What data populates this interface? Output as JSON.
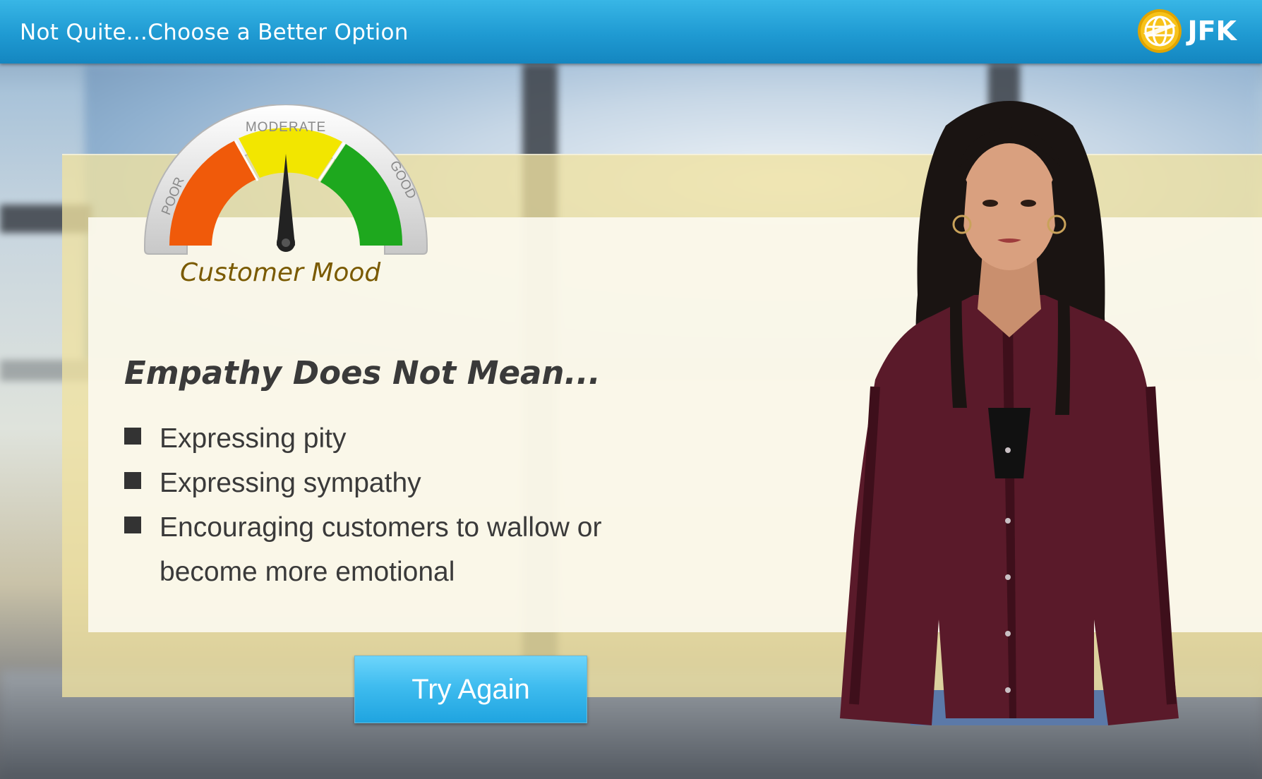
{
  "header": {
    "title": "Not Quite...Choose a Better Option",
    "logo_text": "JFK"
  },
  "gauge": {
    "labels": {
      "poor": "POOR",
      "moderate": "MODERATE",
      "good": "GOOD"
    },
    "caption": "Customer Mood",
    "level": "moderate",
    "colors": {
      "poor": "#f05a0a",
      "moderate": "#f2e600",
      "good": "#1ea81e"
    }
  },
  "content": {
    "heading": "Empathy Does Not Mean...",
    "bullets": [
      "Expressing pity",
      "Expressing sympathy",
      "Encouraging customers to wallow or become more emotional"
    ]
  },
  "actions": {
    "try_again_label": "Try Again"
  },
  "colors": {
    "header": "#1f9ad2",
    "button": "#3fbcef"
  }
}
